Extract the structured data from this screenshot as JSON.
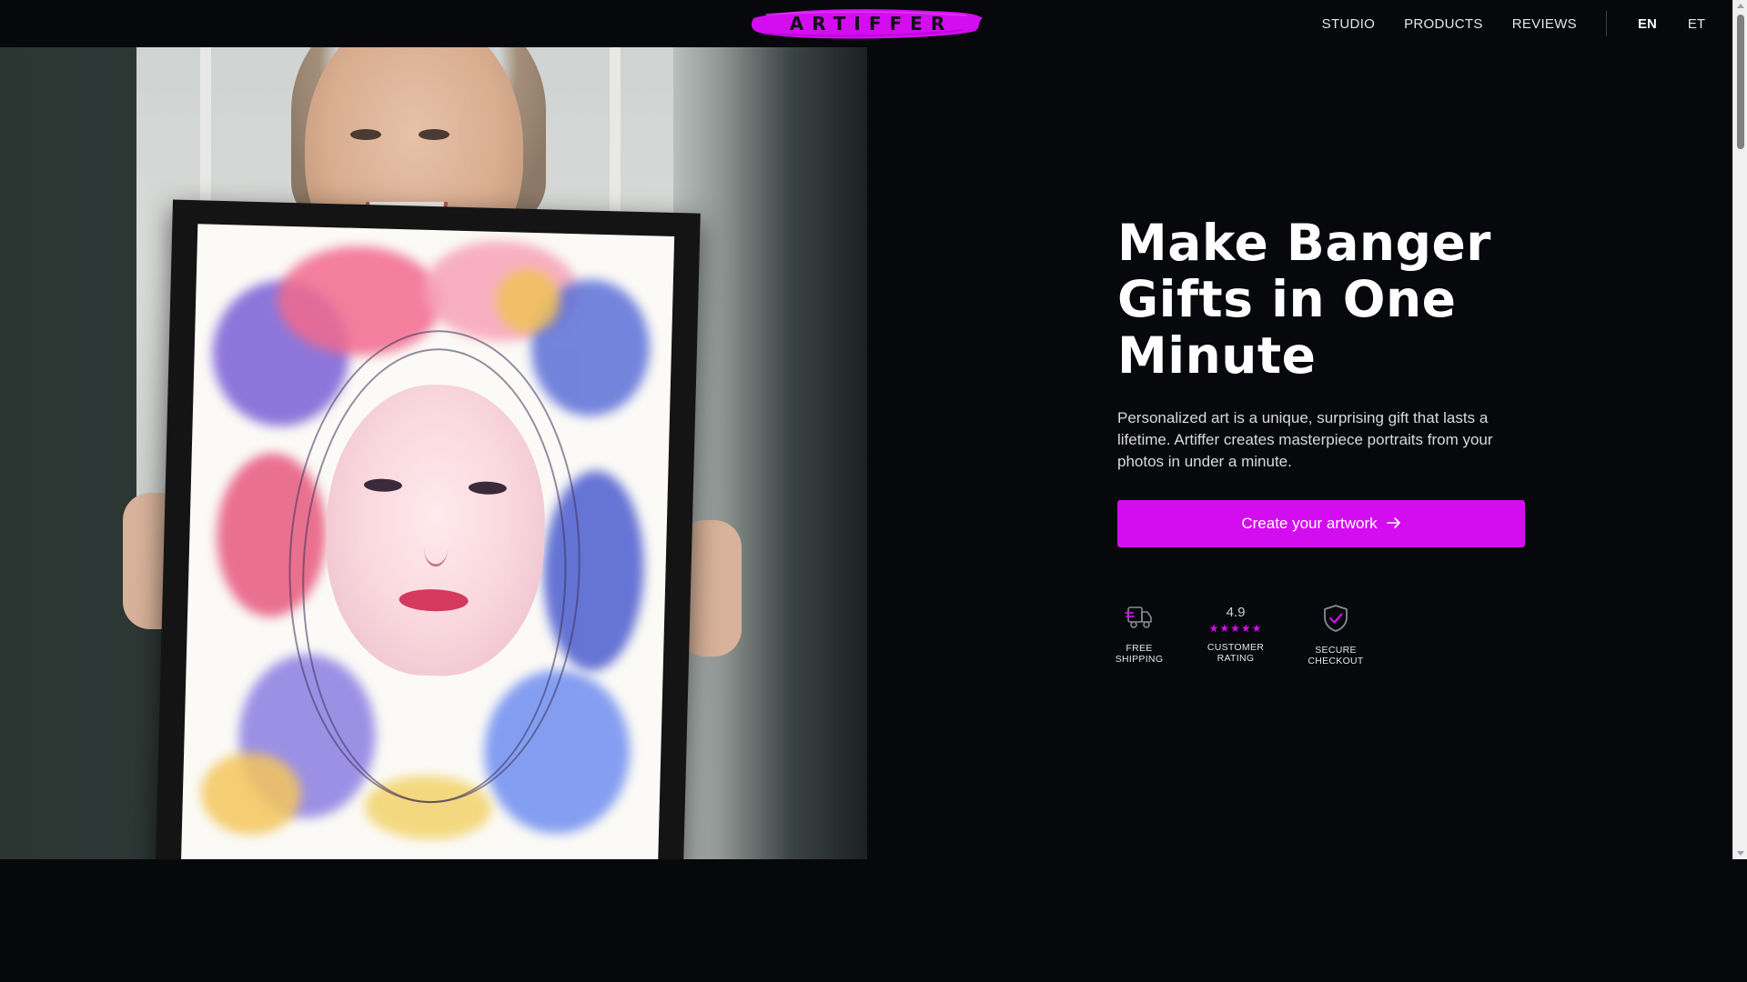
{
  "brand": {
    "logo_text": "ARTIFFER",
    "logo_color": "#d40cf0"
  },
  "nav": {
    "links": [
      "STUDIO",
      "PRODUCTS",
      "REVIEWS"
    ],
    "languages": [
      "EN",
      "ET"
    ],
    "active_language": "EN"
  },
  "hero": {
    "headline_lines": [
      "Make Banger",
      "Gifts in One",
      "Minute"
    ],
    "subtext": "Personalized art is a unique, surprising gift that lasts a lifetime. Artiffer creates masterpiece portraits from your photos in under a minute.",
    "cta_label": "Create your artwork",
    "cta_icon": "arrow-right-icon",
    "accent_color": "#d40cf0"
  },
  "badges": {
    "shipping": {
      "icon": "truck-icon",
      "label_lines": [
        "FREE",
        "SHIPPING"
      ]
    },
    "rating": {
      "value": "4.9",
      "stars": "★★★★★",
      "star_count": 5,
      "label_lines": [
        "CUSTOMER",
        "RATING"
      ]
    },
    "checkout": {
      "icon": "shield-check-icon",
      "label_lines": [
        "SECURE",
        "CHECKOUT"
      ]
    }
  },
  "colors": {
    "background": "#07080b",
    "text": "#ffffff",
    "muted_text": "#d9d9df"
  }
}
